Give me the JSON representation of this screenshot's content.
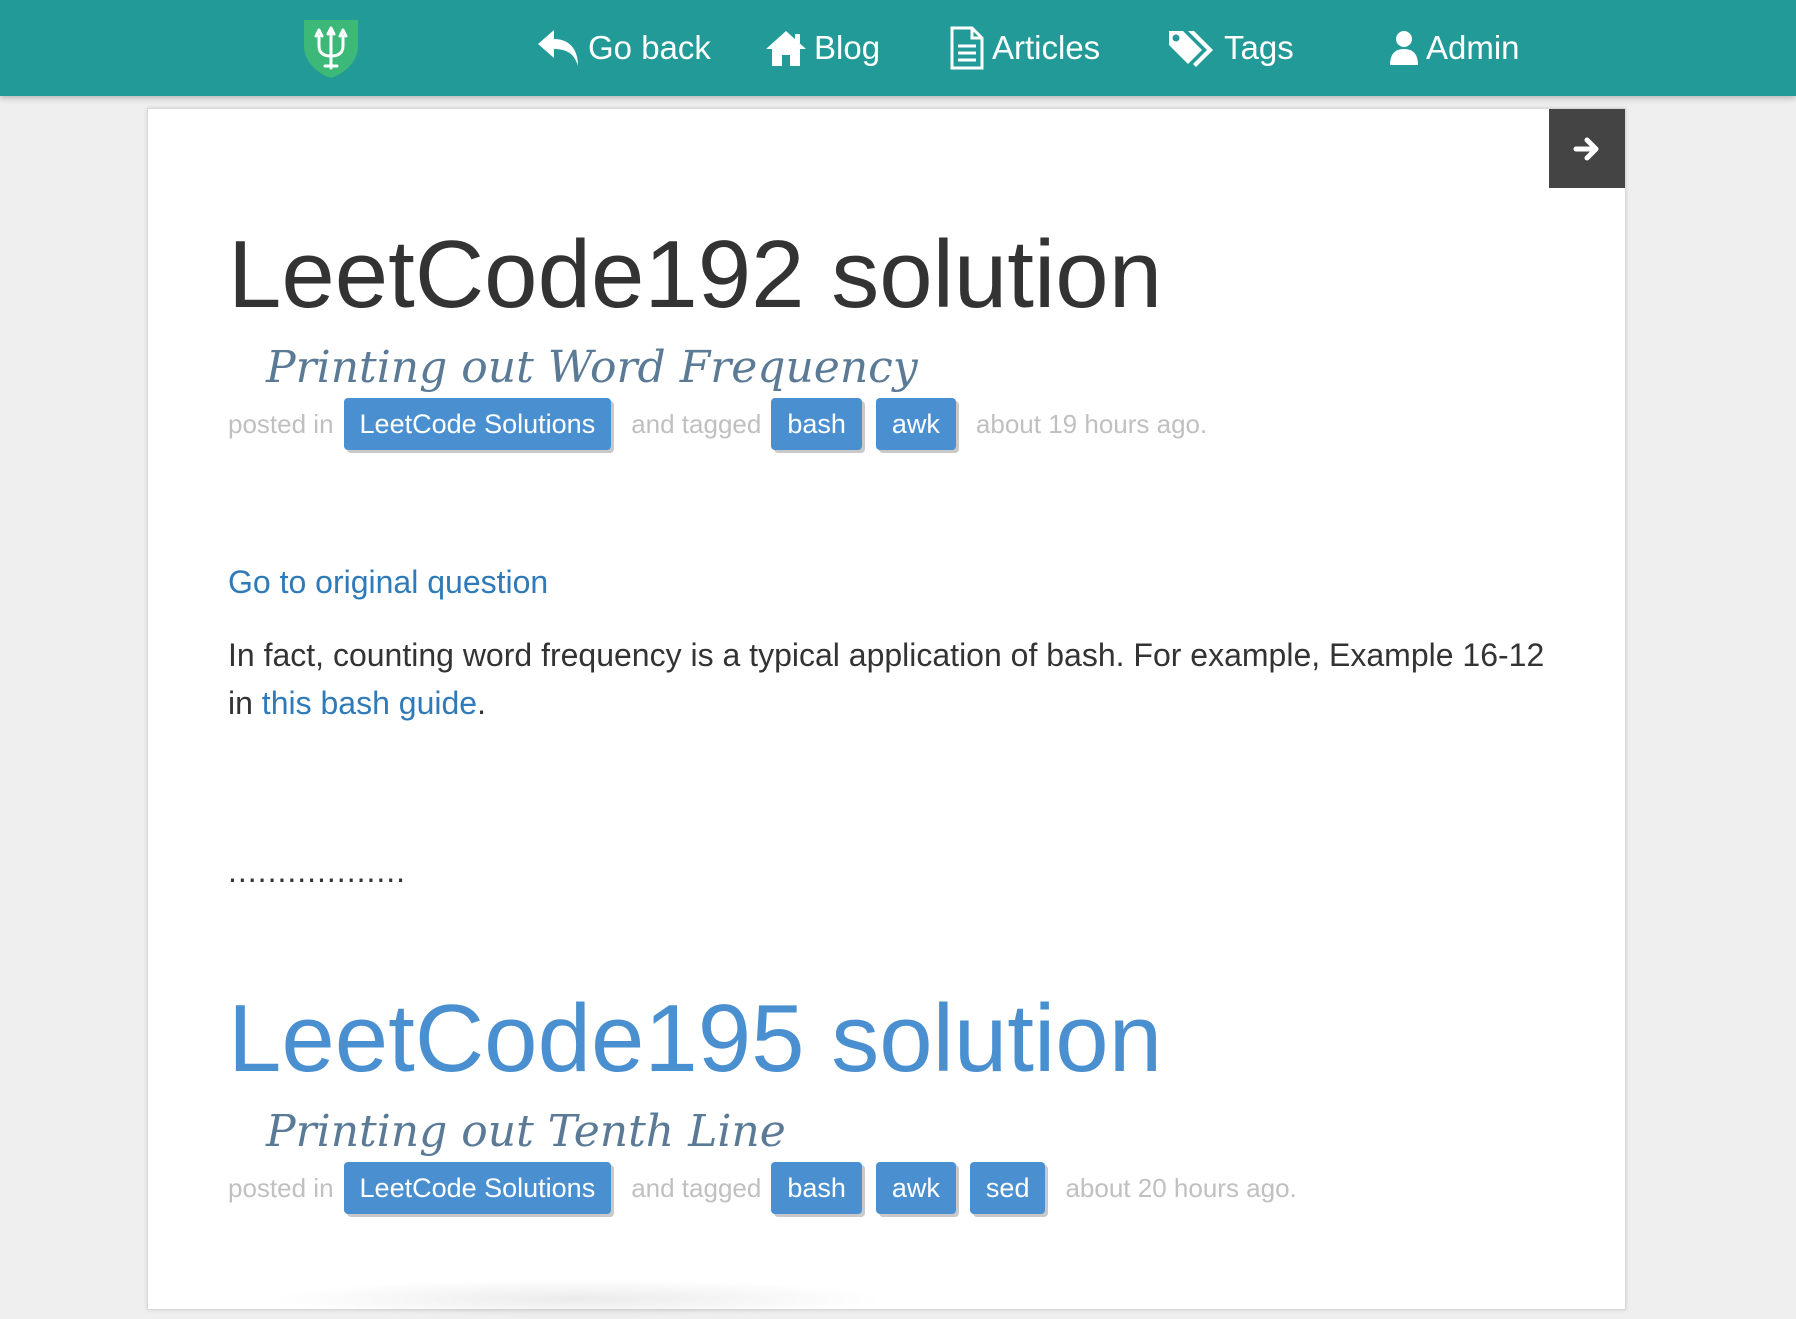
{
  "navbar": {
    "background": "#229a98",
    "logo_icon": "trident-shield-icon",
    "items": [
      {
        "label": "Go back",
        "icon": "reply-icon"
      },
      {
        "label": "Blog",
        "icon": "home-icon"
      },
      {
        "label": "Articles",
        "icon": "document-icon"
      },
      {
        "label": "Tags",
        "icon": "tags-icon"
      },
      {
        "label": "Admin",
        "icon": "user-icon"
      }
    ]
  },
  "next_button": {
    "icon": "arrow-right-icon"
  },
  "posts": [
    {
      "title": "LeetCode192 solution",
      "subtitle": "Printing out Word Frequency",
      "meta": {
        "posted_in": "posted in",
        "category": "LeetCode Solutions",
        "and_tagged": "and tagged",
        "tags": [
          "bash",
          "awk"
        ],
        "time": "about 19 hours ago."
      },
      "body": {
        "link": "Go to original question",
        "paragraph_start": "In fact, counting word frequency is a typical application of bash. For example, Example 16-12 in ",
        "paragraph_link": "this bash guide",
        "paragraph_end": ".",
        "ellipsis": ".................."
      }
    },
    {
      "title": "LeetCode195 solution",
      "subtitle": "Printing out Tenth Line",
      "meta": {
        "posted_in": "posted in",
        "category": "LeetCode Solutions",
        "and_tagged": "and tagged",
        "tags": [
          "bash",
          "awk",
          "sed"
        ],
        "time": "about 20 hours ago."
      }
    }
  ],
  "colors": {
    "accent": "#4a90d0",
    "link": "#2f7ab8",
    "subtitle": "#5a7a96",
    "meta_text": "#c0c0c0"
  }
}
